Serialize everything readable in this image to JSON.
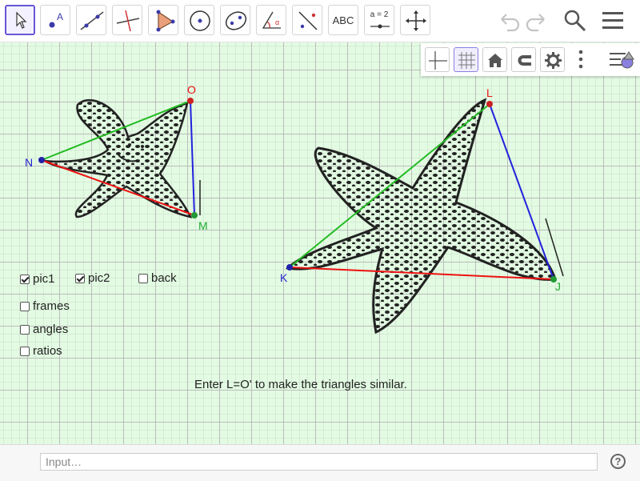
{
  "toolbar": {
    "text_tool_label": "ABC",
    "slider_tool_label": "a = 2"
  },
  "checkboxes": [
    {
      "label": "pic1",
      "checked": true
    },
    {
      "label": "pic2",
      "checked": true
    },
    {
      "label": "back",
      "checked": false
    },
    {
      "label": "frames",
      "checked": false
    },
    {
      "label": "angles",
      "checked": false
    },
    {
      "label": "ratios",
      "checked": false
    }
  ],
  "hint_text": "Enter L=O' to make the triangles similar.",
  "points": {
    "O": "O",
    "N": "N",
    "M": "M",
    "L": "L",
    "K": "K",
    "J": "J"
  },
  "colors": {
    "segment_top": "#22bb22",
    "segment_right": "#2222dd",
    "segment_bottom": "#ee1111",
    "label_O_L": "#ee1111",
    "label_N_K": "#2222cc",
    "label_M_J": "#22aa33",
    "accent": "#6557d2"
  },
  "input_bar": {
    "placeholder": "Input…",
    "help_label": "?"
  }
}
